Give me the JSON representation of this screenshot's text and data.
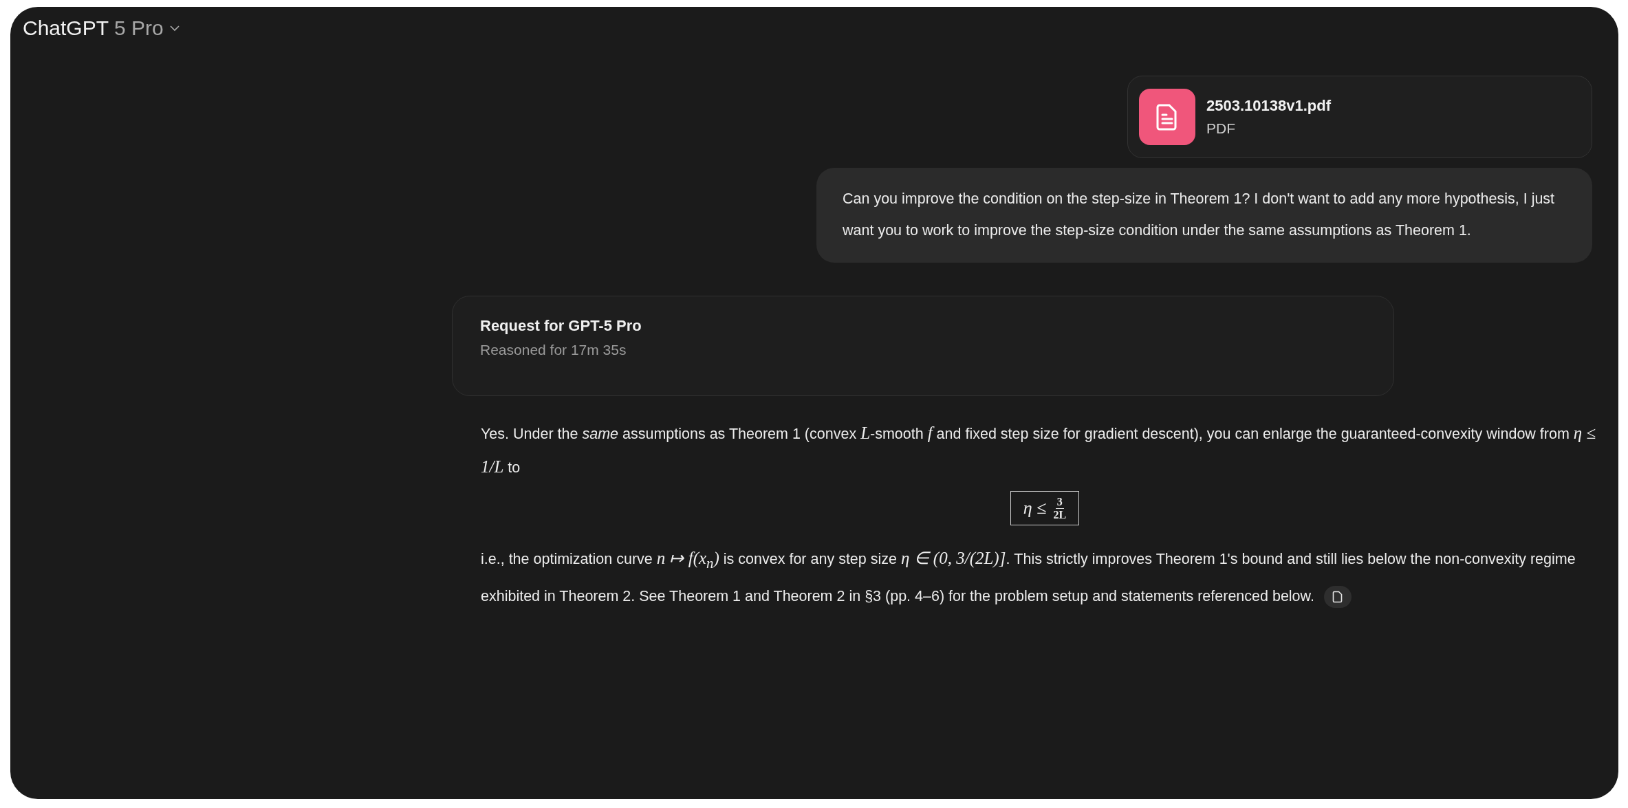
{
  "header": {
    "title": "ChatGPT",
    "model": "5 Pro"
  },
  "attachment": {
    "name": "2503.10138v1.pdf",
    "type": "PDF"
  },
  "user_message": "Can you improve the condition on the step-size in Theorem 1? I don't want to add any more hypothesis, I just want you to work to improve the step-size condition under the same assumptions as Theorem 1.",
  "request": {
    "title": "Request for GPT-5 Pro",
    "subtitle": "Reasoned for 17m 35s"
  },
  "answer": {
    "paragraphs": [
      [
        {
          "kind": "text",
          "text": "Yes. Under the "
        },
        {
          "kind": "em",
          "text": "same"
        },
        {
          "kind": "text",
          "text": " assumptions as Theorem 1 (convex "
        },
        {
          "kind": "math",
          "text": "L"
        },
        {
          "kind": "text",
          "text": "-smooth "
        },
        {
          "kind": "math",
          "text": "f"
        },
        {
          "kind": "text",
          "text": " and fixed step size for gradient descent), you can enlarge the guaranteed-convexity window from "
        },
        {
          "kind": "math",
          "text": "η ≤ 1/L"
        },
        {
          "kind": "text",
          "text": " to"
        }
      ],
      {
        "kind": "boxed_formula",
        "lhs": "η ≤",
        "numerator": "3",
        "denominator": "2L"
      },
      [
        {
          "kind": "text",
          "text": "i.e., the optimization curve "
        },
        {
          "kind": "math",
          "text": "n ↦ f(x$_{n}$)"
        },
        {
          "kind": "text",
          "text": " is convex for any step size "
        },
        {
          "kind": "math",
          "text": "η ∈ (0, 3/(2L)]"
        },
        {
          "kind": "text",
          "text": ". This strictly improves Theorem 1's bound and still lies below the non-convexity regime exhibited in Theorem 2. See Theorem 1 and Theorem 2 in §3 (pp. 4–6) for the problem setup and statements referenced below."
        },
        {
          "kind": "source"
        }
      ]
    ]
  }
}
